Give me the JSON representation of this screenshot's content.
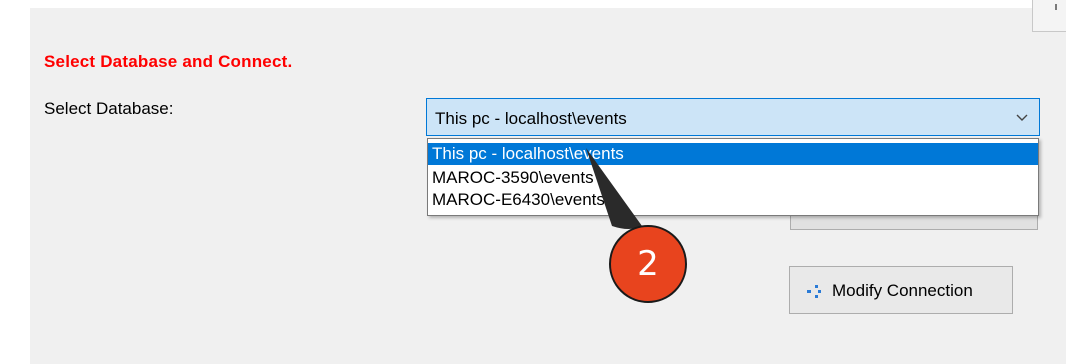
{
  "colors": {
    "title_red": "#ff0000",
    "selection_blue": "#0078d7",
    "combo_fill": "#cce4f7",
    "badge_fill": "#e8441e"
  },
  "form": {
    "title": "Select Database and Connect.",
    "database_label": "Select Database:"
  },
  "combo": {
    "value": "This pc - localhost\\events",
    "arrow_icon": "chevron-down-icon"
  },
  "dropdown": {
    "options": [
      {
        "label": "This pc - localhost\\events",
        "selected": true
      },
      {
        "label": "MAROC-3590\\events",
        "selected": false
      },
      {
        "label": "MAROC-E6430\\events",
        "selected": false
      }
    ]
  },
  "modify_button": {
    "label": "Modify Connection",
    "icon": "connection-icon"
  },
  "annotation": {
    "number": "2"
  }
}
